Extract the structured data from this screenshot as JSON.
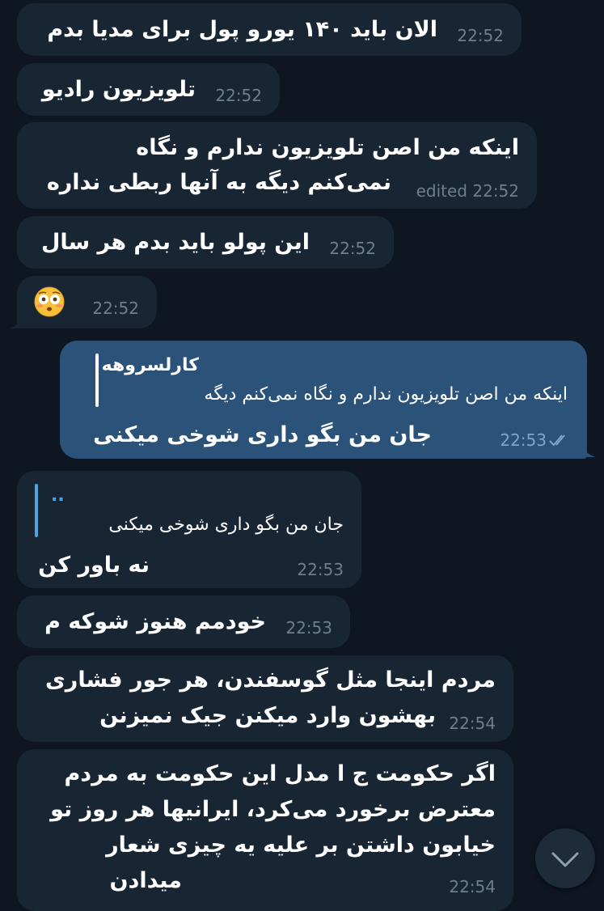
{
  "messages": [
    {
      "text": "الان باید ۱۴۰ یورو پول برای مدیا بدم",
      "time": "22:52"
    },
    {
      "text": "تلویزیون رادیو",
      "time": "22:52"
    },
    {
      "lines": [
        "اینکه من اصن تلویزیون ندارم و نگاه",
        "نمی‌کنم دیگه به آنها ربطی نداره"
      ],
      "time": "edited 22:52"
    },
    {
      "text": "این پولو باید بدم هر سال",
      "time": "22:52"
    },
    {
      "emoji": "flushed-face",
      "time": "22:52"
    },
    {
      "reply_name": "کارلسروهه",
      "reply_text": "اینکه من اصن تلویزیون ندارم و نگاه نمی‌کنم دیگه",
      "text": "جان من بگو داری شوخی میکنی",
      "time": "22:53"
    },
    {
      "reply_name": "..",
      "reply_text": "جان من بگو داری شوخی میکنی",
      "text": "نه باور کن",
      "time": "22:53"
    },
    {
      "text": "خودمم هنوز شوکه م",
      "time": "22:53"
    },
    {
      "lines": [
        "مردم اینجا مثل گوسفندن، هر جور فشاری",
        "بهشون وارد میکنن جیک نمیزنن"
      ],
      "time": "22:54"
    },
    {
      "lines": [
        "اگر حکومت ج ا مدل این حکومت به مردم",
        "معترض برخورد می‌کرد،  ایرانیها هر روز تو",
        "خیابون داشتن بر علیه یه  چیزی شعار",
        "میدادن"
      ],
      "time": "22:54"
    }
  ],
  "colors": {
    "background": "#0e1621",
    "incoming_bubble": "#182533",
    "outgoing_bubble": "#2b5278",
    "accent": "#4fa3e0"
  },
  "icons": {
    "read_receipt": "double-check-icon",
    "scroll_down": "chevron-down-icon"
  }
}
